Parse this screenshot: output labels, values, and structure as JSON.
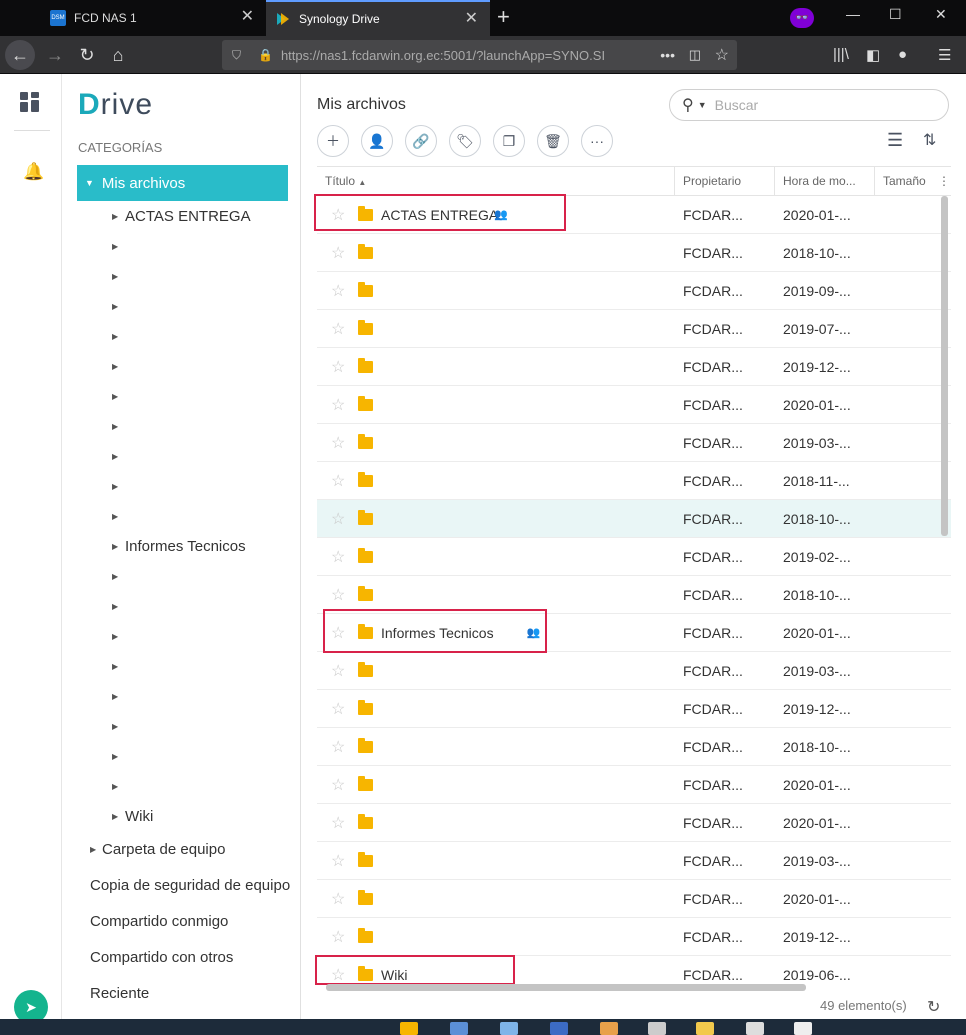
{
  "browser": {
    "tabs": [
      {
        "label": "FCD NAS 1",
        "badge": "DSM"
      },
      {
        "label": "Synology Drive"
      }
    ],
    "url": "https://nas1.fcdarwin.org.ec:5001/?launchApp=SYNO.SI"
  },
  "sidebar": {
    "logo": "rive",
    "logo_letter": "D",
    "category_title": "CATEGORÍAS",
    "selected": "Mis archivos",
    "tree": [
      "ACTAS ENTREGA",
      "",
      "",
      "",
      "",
      "",
      "",
      "",
      "",
      "",
      "",
      "Informes Tecnicos",
      "",
      "",
      "",
      "",
      "",
      "",
      "",
      "",
      "Wiki"
    ],
    "items": [
      "Carpeta de equipo",
      "Copia de seguridad de equipo",
      "Compartido conmigo",
      "Compartido con otros",
      "Reciente"
    ]
  },
  "main": {
    "title": "Mis archivos",
    "search_placeholder": "Buscar",
    "columns": {
      "title": "Título",
      "owner": "Propietario",
      "date": "Hora de mo...",
      "size": "Tamaño"
    },
    "rows": [
      {
        "name": "ACTAS ENTREGA",
        "owner": "FCDAR...",
        "date": "2020-01-...",
        "shared": true
      },
      {
        "name": "",
        "owner": "FCDAR...",
        "date": "2018-10-..."
      },
      {
        "name": "",
        "owner": "FCDAR...",
        "date": "2019-09-..."
      },
      {
        "name": "",
        "owner": "FCDAR...",
        "date": "2019-07-..."
      },
      {
        "name": "",
        "owner": "FCDAR...",
        "date": "2019-12-..."
      },
      {
        "name": "",
        "owner": "FCDAR...",
        "date": "2020-01-..."
      },
      {
        "name": "",
        "owner": "FCDAR...",
        "date": "2019-03-..."
      },
      {
        "name": "",
        "owner": "FCDAR...",
        "date": "2018-11-..."
      },
      {
        "name": "",
        "owner": "FCDAR...",
        "date": "2018-10-...",
        "selected": true
      },
      {
        "name": "",
        "owner": "FCDAR...",
        "date": "2019-02-..."
      },
      {
        "name": "",
        "owner": "FCDAR...",
        "date": "2018-10-..."
      },
      {
        "name": "Informes Tecnicos",
        "owner": "FCDAR...",
        "date": "2020-01-...",
        "shared": true
      },
      {
        "name": "",
        "owner": "FCDAR...",
        "date": "2019-03-..."
      },
      {
        "name": "",
        "owner": "FCDAR...",
        "date": "2019-12-..."
      },
      {
        "name": "",
        "owner": "FCDAR...",
        "date": "2018-10-..."
      },
      {
        "name": "",
        "owner": "FCDAR...",
        "date": "2020-01-..."
      },
      {
        "name": "",
        "owner": "FCDAR...",
        "date": "2020-01-..."
      },
      {
        "name": "",
        "owner": "FCDAR...",
        "date": "2019-03-..."
      },
      {
        "name": "",
        "owner": "FCDAR...",
        "date": "2020-01-..."
      },
      {
        "name": "",
        "owner": "FCDAR...",
        "date": "2019-12-..."
      },
      {
        "name": "Wiki",
        "owner": "FCDAR...",
        "date": "2019-06-..."
      }
    ],
    "item_count": "49 elemento(s)"
  },
  "colors": {
    "accent": "#29bcc9",
    "highlight": "#d8224a",
    "folder": "#f7b500"
  }
}
